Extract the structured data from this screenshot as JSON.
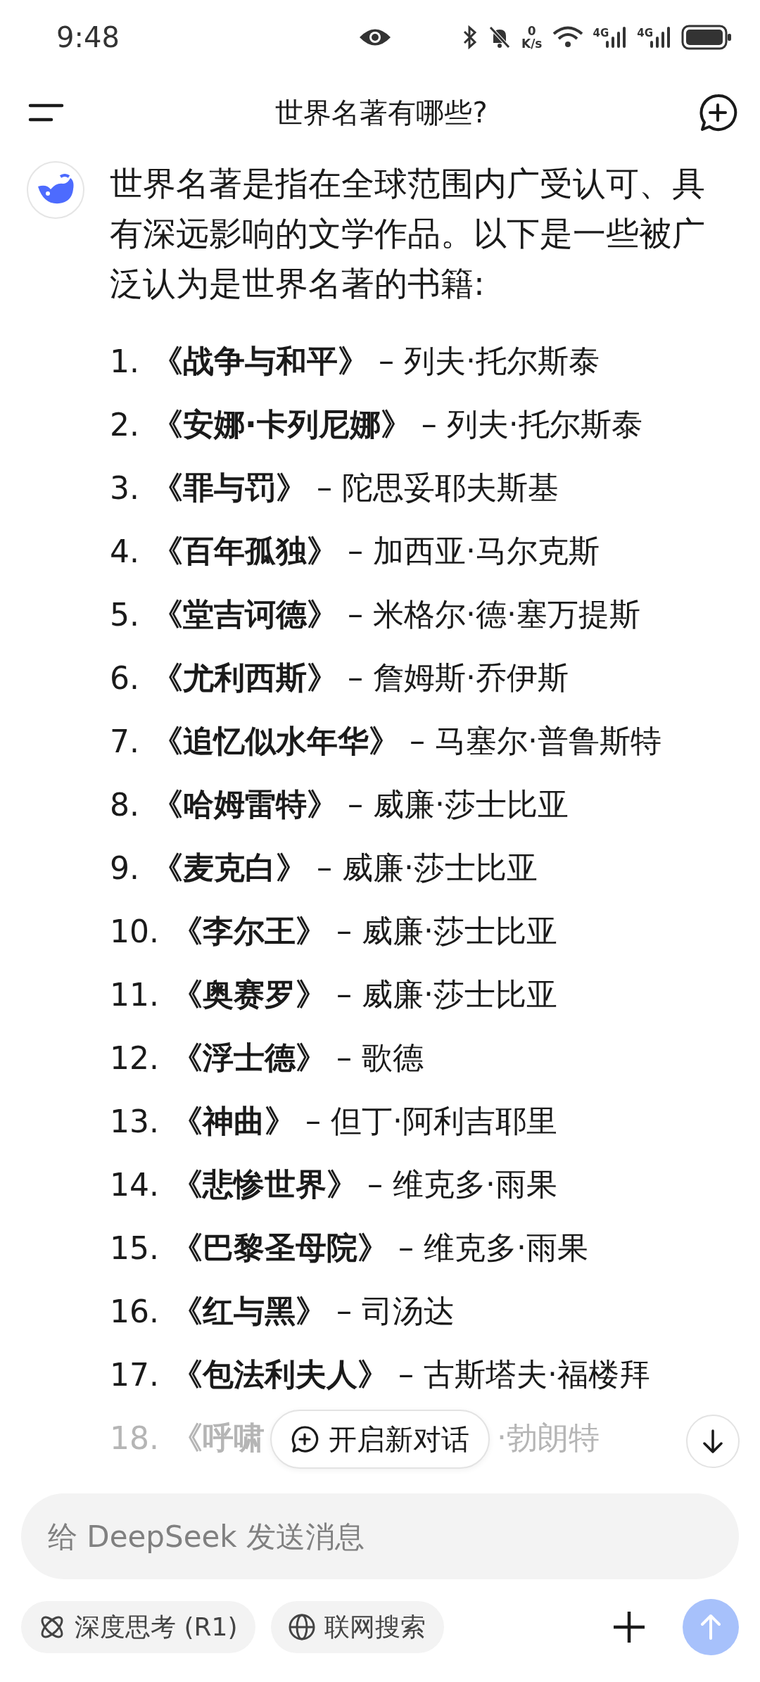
{
  "status_bar": {
    "time": "9:48",
    "net_speed_value": "0",
    "net_speed_unit": "K/s",
    "signals": [
      "4G",
      "4G"
    ]
  },
  "header": {
    "title": "世界名著有哪些?"
  },
  "message": {
    "intro": "世界名著是指在全球范围内广受认可、具有深远影响的文学作品。以下是一些被广泛认为是世界名著的书籍:",
    "items": [
      {
        "kind": "line",
        "number": "1.",
        "text": "**《战争与和平》** – 列夫·托尔斯泰"
      },
      {
        "kind": "line",
        "number": "2.",
        "text": "**《安娜·卡列尼娜》** – 列夫·托尔斯泰"
      },
      {
        "kind": "line",
        "number": "3.",
        "text": "**《罪与罚》** – 陀思妥耶夫斯基"
      },
      {
        "kind": "line",
        "number": "4.",
        "text": "**《百年孤独》** – 加西亚·马尔克斯"
      },
      {
        "kind": "line",
        "number": "5.",
        "text": "**《堂吉诃德》** – 米格尔·德·塞万提斯"
      },
      {
        "kind": "line",
        "number": "6.",
        "text": "**《尤利西斯》** – 詹姆斯·乔伊斯"
      },
      {
        "kind": "line",
        "number": "7.",
        "text": "**《追忆似水年华》** – 马塞尔·普鲁斯特"
      },
      {
        "kind": "line",
        "number": "8.",
        "text": "**《哈姆雷特》** – 威廉·莎士比亚"
      },
      {
        "kind": "line",
        "number": "9.",
        "text": "**《麦克白》** – 威廉·莎士比亚"
      },
      {
        "kind": "line",
        "number": "10.",
        "text": "**《李尔王》** – 威廉·莎士比亚"
      },
      {
        "kind": "line",
        "number": "11.",
        "text": "**《奥赛罗》** – 威廉·莎士比亚"
      },
      {
        "kind": "line",
        "number": "12.",
        "text": "**《浮士德》** – 歌德"
      },
      {
        "kind": "line",
        "number": "13.",
        "text": "**《神曲》** – 但丁·阿利吉耶里"
      },
      {
        "kind": "line",
        "number": "14.",
        "text": "**《悲惨世界》** – 维克多·雨果"
      },
      {
        "kind": "line",
        "number": "15.",
        "text": "**《巴黎圣母院》** – 维克多·雨果"
      },
      {
        "kind": "line",
        "number": "16.",
        "text": "**《红与黑》** – 司汤达"
      },
      {
        "kind": "line",
        "number": "17.",
        "text": "**《包法利夫人》** – 古斯塔夫·福楼拜"
      },
      {
        "kind": "covered",
        "number": "18.",
        "text": "**《呼啸**",
        "text_after": "·勃朗特"
      }
    ]
  },
  "new_chat_button": {
    "label": "开启新对话"
  },
  "composer": {
    "placeholder": "给 DeepSeek 发送消息",
    "chips": [
      {
        "kind": "deep-think",
        "label": "深度思考 (R1)",
        "selected": false
      },
      {
        "kind": "web-search",
        "label": "联网搜索",
        "selected": false
      }
    ],
    "send_disabled": true
  }
}
